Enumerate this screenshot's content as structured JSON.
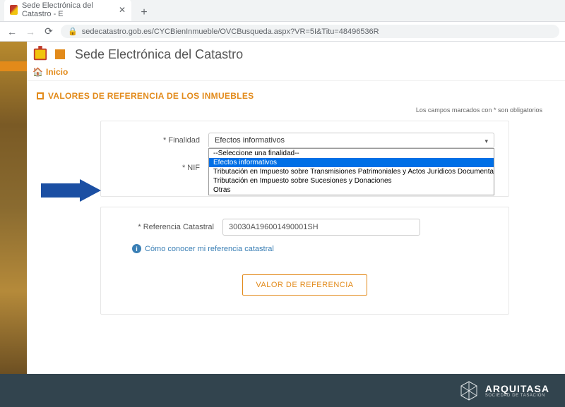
{
  "browser": {
    "tab_title": "Sede Electrónica del Catastro - E",
    "url": "sedecatastro.gob.es/CYCBienInmueble/OVCBusqueda.aspx?VR=5I&Titu=48496536R"
  },
  "header": {
    "title": "Sede Electrónica del Catastro",
    "home_label": "Inicio"
  },
  "section": {
    "title": "VALORES DE REFERENCIA DE LOS INMUEBLES",
    "mandatory_note": "Los campos marcados con * son obligatorios"
  },
  "form": {
    "finalidad_label": "* Finalidad",
    "finalidad_selected": "Efectos informativos",
    "finalidad_options": {
      "placeholder": "--Seleccione una finalidad--",
      "opt1": "Efectos informativos",
      "opt2": "Tributación en Impuesto sobre Transmisiones Patrimoniales y Actos Jurídicos Documentados",
      "opt3": "Tributación en Impuesto sobre Sucesiones y Donaciones",
      "opt4": "Otras"
    },
    "nif_label": "* NIF",
    "ref_label": "* Referencia Catastral",
    "ref_value": "30030A196001490001SH",
    "info_link": "Cómo conocer mi referencia catastral",
    "submit_label": "VALOR DE REFERENCIA"
  },
  "footer": {
    "brand": "ARQUITASA",
    "tagline": "SOCIEDAD DE TASACIÓN"
  }
}
